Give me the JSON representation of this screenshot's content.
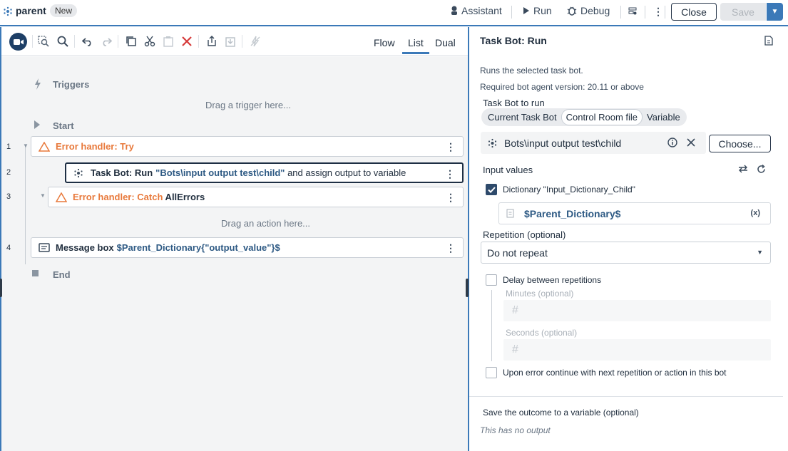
{
  "header": {
    "title": "parent",
    "badge": "New",
    "assistant": "Assistant",
    "run": "Run",
    "debug": "Debug",
    "close": "Close",
    "save": "Save"
  },
  "editor": {
    "views": [
      "Flow",
      "List",
      "Dual"
    ],
    "active_view": "List",
    "triggers_label": "Triggers",
    "trigger_hint": "Drag a trigger here...",
    "start_label": "Start",
    "end_label": "End",
    "action_hint": "Drag an action here...",
    "rows": [
      {
        "num": "1",
        "prefix": "Error handler: Try",
        "rest": ""
      },
      {
        "num": "2",
        "prefix": "Task Bot: Run",
        "code": "\"Bots\\input output test\\child\"",
        "rest": " and assign output to variable"
      },
      {
        "num": "3",
        "prefix": "Error handler: Catch",
        "rest": " AllErrors"
      },
      {
        "num": "4",
        "prefix": "Message box",
        "code": "$Parent_Dictionary{\"output_value\"}$",
        "rest": ""
      }
    ]
  },
  "panel": {
    "title": "Task Bot: Run",
    "description": "Runs the selected task bot.",
    "version_note": "Required bot agent version: 20.11 or above",
    "bot_to_run_label": "Task Bot to run",
    "bot_options": [
      "Current Task Bot",
      "Control Room file",
      "Variable"
    ],
    "bot_selected": "Control Room file",
    "file_path": "Bots\\input output test\\child",
    "choose_label": "Choose...",
    "input_values_label": "Input values",
    "dictionary_label": "Dictionary \"Input_Dictionary_Child\"",
    "dictionary_value": "$Parent_Dictionary$",
    "var_badge": "(x)",
    "repetition_label": "Repetition (optional)",
    "repetition_value": "Do not repeat",
    "delay_label": "Delay between repetitions",
    "minutes_label": "Minutes (optional)",
    "seconds_label": "Seconds (optional)",
    "hash_placeholder": "#",
    "error_continue_label": "Upon error continue with next repetition or action in this bot",
    "save_outcome_label": "Save the outcome to a variable (optional)",
    "no_output": "This has no output"
  }
}
